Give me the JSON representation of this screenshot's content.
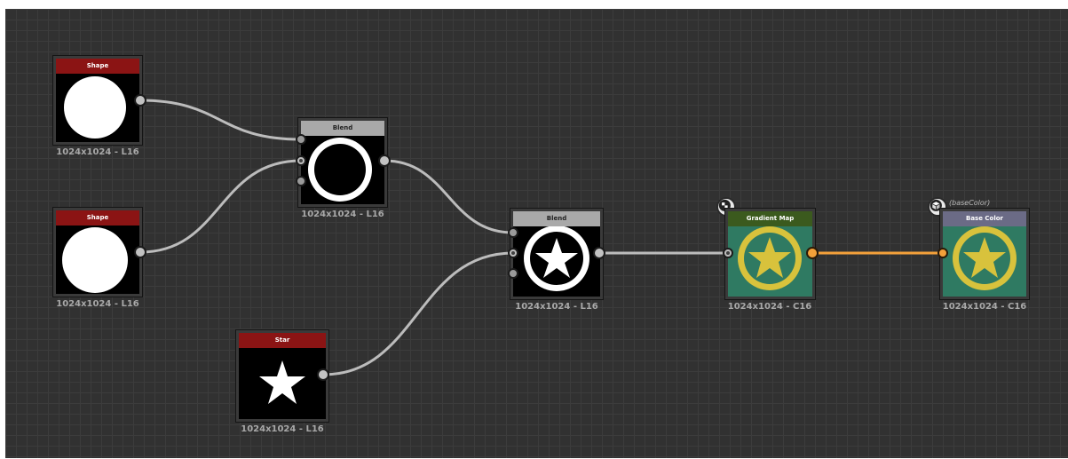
{
  "graph": {
    "nodes": {
      "shape1": {
        "title": "Shape",
        "resolution": "1024x1024 - L16",
        "header_color": "#8b1414",
        "thumbnail": "white-disc"
      },
      "shape2": {
        "title": "Shape",
        "resolution": "1024x1024 - L16",
        "header_color": "#8b1414",
        "thumbnail": "white-disc"
      },
      "star": {
        "title": "Star",
        "resolution": "1024x1024 - L16",
        "header_color": "#8b1414",
        "thumbnail": "white-star"
      },
      "blend1": {
        "title": "Blend",
        "resolution": "1024x1024 - L16",
        "header_color": "#a9a9a9",
        "thumbnail": "white-ring"
      },
      "blend2": {
        "title": "Blend",
        "resolution": "1024x1024 - L16",
        "header_color": "#a9a9a9",
        "thumbnail": "star-in-ring"
      },
      "gradient_map": {
        "title": "Gradient Map",
        "resolution": "1024x1024 - C16",
        "header_color": "#3b5a1e",
        "thumbnail": "yellow-star-on-green",
        "badge_icon": "checker-icon"
      },
      "base_color": {
        "title": "Base Color",
        "resolution": "1024x1024 - C16",
        "header_color": "#6b6b86",
        "thumbnail": "yellow-star-on-green",
        "badge_icon": "cube-icon",
        "usage_label": "(baseColor)"
      }
    },
    "connections": [
      {
        "from": "shape1.output",
        "to": "blend1.foreground",
        "color": "#bcbcbc"
      },
      {
        "from": "shape2.output",
        "to": "blend1.background",
        "color": "#bcbcbc"
      },
      {
        "from": "blend1.output",
        "to": "blend2.foreground",
        "color": "#bcbcbc"
      },
      {
        "from": "star.output",
        "to": "blend2.background",
        "color": "#bcbcbc"
      },
      {
        "from": "blend2.output",
        "to": "gradient_map.input",
        "color": "#bcbcbc"
      },
      {
        "from": "gradient_map.output",
        "to": "base_color.input",
        "color": "#f4a13a"
      }
    ],
    "colors": {
      "canvas_bg": "#313131",
      "grid_line": "#3c3c3c",
      "wire_gray": "#bcbcbc",
      "wire_color": "#f4a13a",
      "thumb_green": "#2f7a62",
      "thumb_yellow": "#d8c23c"
    }
  }
}
